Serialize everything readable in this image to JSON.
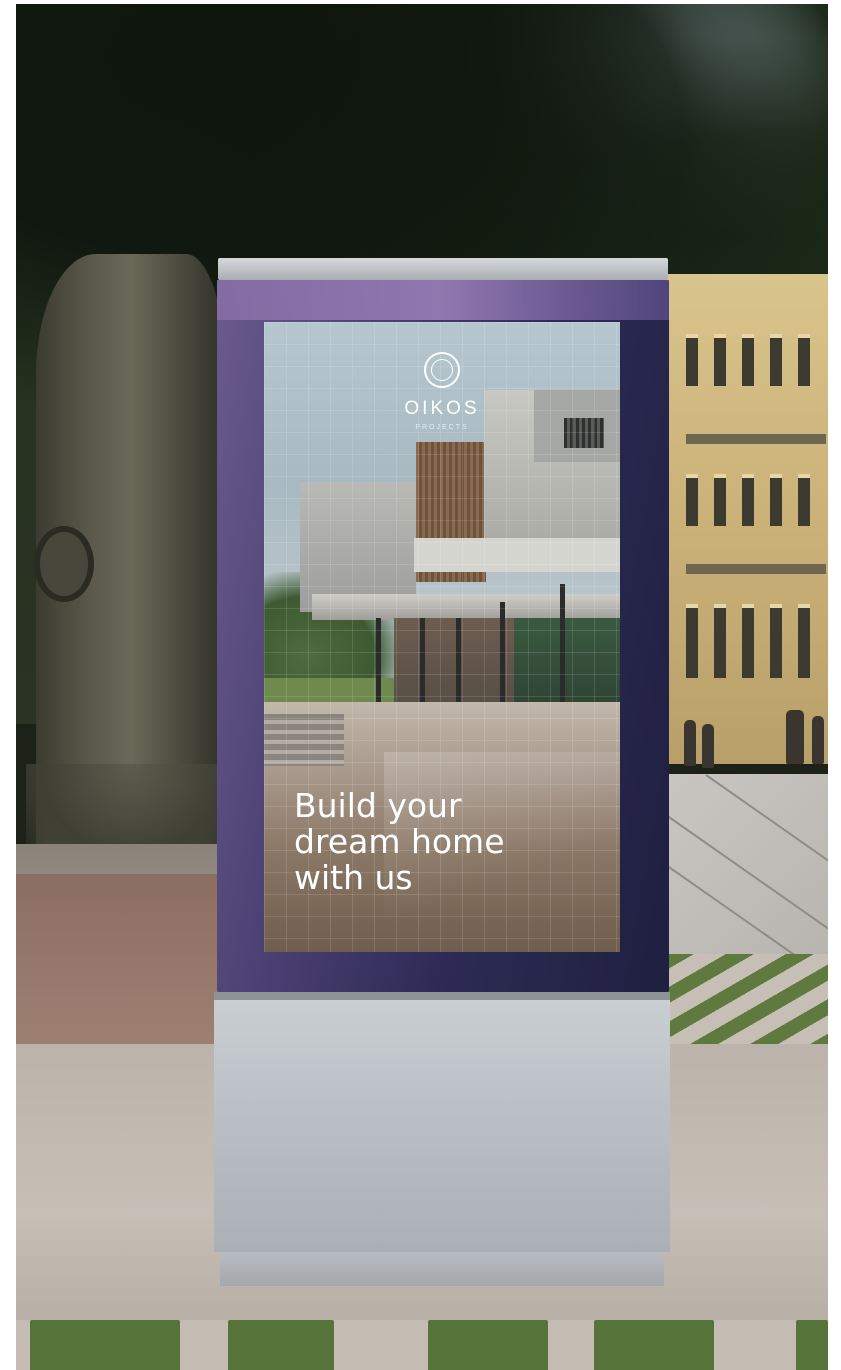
{
  "poster": {
    "brand_name": "OIKOS",
    "brand_tagline": "PROJECTS",
    "headline_lines": [
      "Build your",
      "dream home",
      "with us"
    ]
  },
  "scene": {
    "subject": "street advertising kiosk",
    "frame_color": "#3a3568",
    "base_color": "#c3c8cc"
  }
}
